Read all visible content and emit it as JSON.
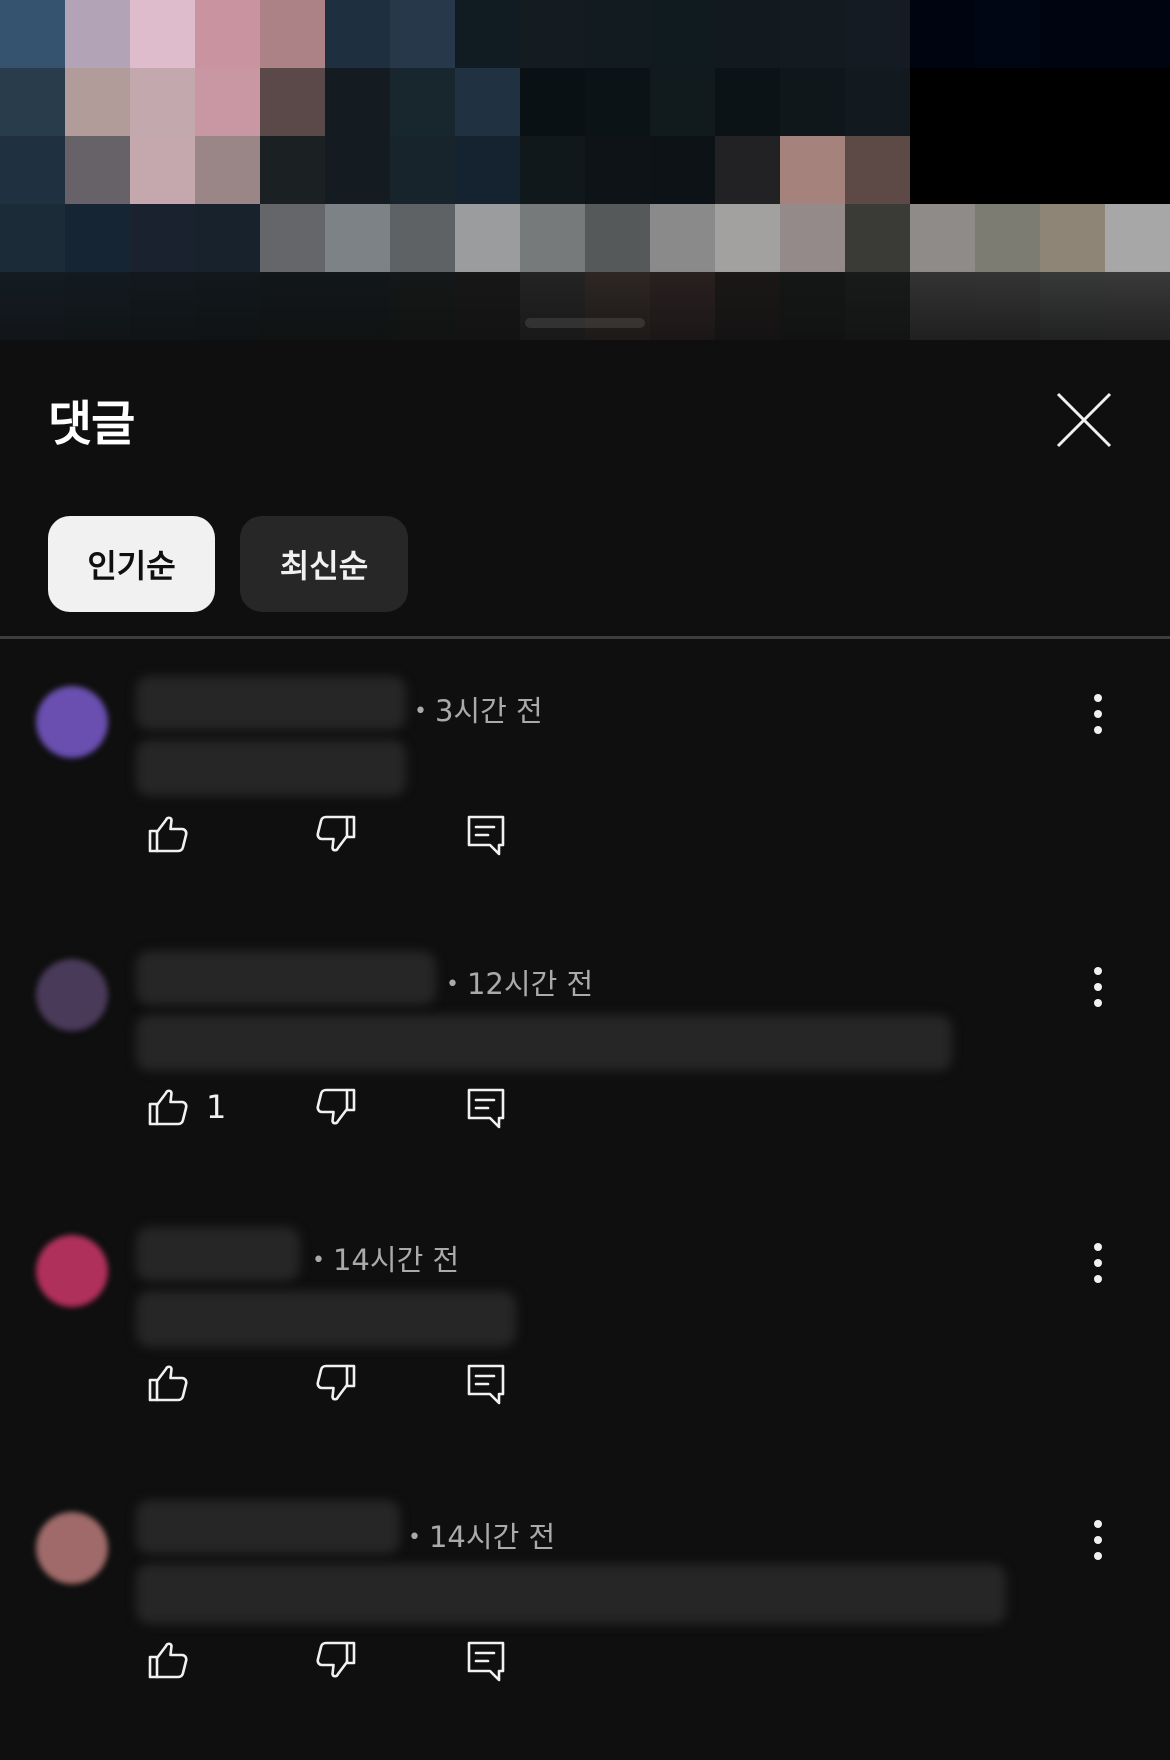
{
  "sheet": {
    "title": "댓글",
    "close_icon": "close-icon"
  },
  "sort": {
    "options": [
      {
        "label": "인기순",
        "selected": true
      },
      {
        "label": "최신순",
        "selected": false
      }
    ]
  },
  "comments": [
    {
      "time": "3시간 전",
      "likes": "",
      "avatar_color": "#6a4fb0"
    },
    {
      "time": "12시간 전",
      "likes": "1",
      "avatar_color": "#4a3a5a"
    },
    {
      "time": "14시간 전",
      "likes": "",
      "avatar_color": "#b0305c"
    },
    {
      "time": "14시간 전",
      "likes": "",
      "avatar_color": "#a06a6a"
    }
  ],
  "icons": {
    "like": "thumbs-up-icon",
    "dislike": "thumbs-down-icon",
    "reply": "reply-icon",
    "more": "more-vert-icon"
  },
  "colors": {
    "background": "#0f0f0f",
    "chip_active_bg": "#f1f1f1",
    "chip_inactive_bg": "#272727",
    "secondary_text": "#aaaaaa"
  }
}
